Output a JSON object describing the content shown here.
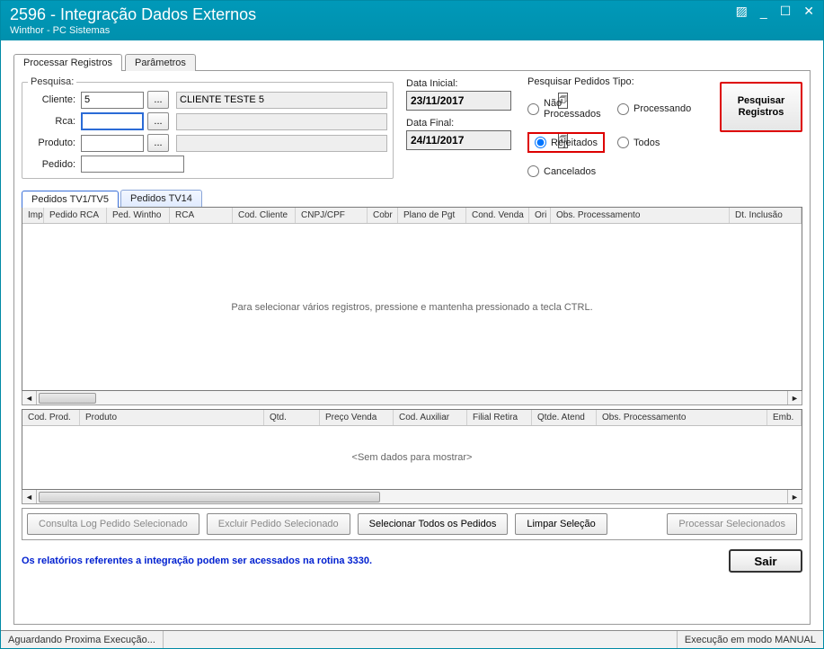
{
  "window": {
    "title": "2596 - Integração Dados Externos",
    "subtitle": "Winthor - PC Sistemas"
  },
  "tabs": {
    "main": [
      {
        "label": "Processar Registros",
        "active": true
      },
      {
        "label": "Parâmetros",
        "active": false
      }
    ],
    "sub": [
      {
        "label": "Pedidos TV1/TV5",
        "active": true
      },
      {
        "label": "Pedidos TV14",
        "active": false
      }
    ]
  },
  "pesquisa": {
    "legend": "Pesquisa:",
    "labels": {
      "cliente": "Cliente:",
      "rca": "Rca:",
      "produto": "Produto:",
      "pedido": "Pedido:"
    },
    "cliente_cod": "5",
    "cliente_desc": "CLIENTE TESTE 5",
    "rca_cod": "",
    "rca_desc": "",
    "produto_cod": "",
    "produto_desc": "",
    "pedido": "",
    "lookup_label": "..."
  },
  "dates": {
    "label_ini": "Data Inicial:",
    "value_ini": "23/11/2017",
    "label_fim": "Data Final:",
    "value_fim": "24/11/2017"
  },
  "tipo": {
    "title": "Pesquisar Pedidos Tipo:",
    "options": {
      "nao_processados": "Não Processados",
      "processando": "Processando",
      "rejeitados": "Rejeitados",
      "todos": "Todos",
      "cancelados": "Cancelados"
    },
    "selected": "rejeitados"
  },
  "buttons": {
    "pesquisar": "Pesquisar Registros",
    "consulta_log": "Consulta Log Pedido Selecionado",
    "excluir": "Excluir Pedido Selecionado",
    "selecionar_todos": "Selecionar Todos os Pedidos",
    "limpar": "Limpar Seleção",
    "processar": "Processar Selecionados",
    "sair": "Sair"
  },
  "grid1": {
    "columns": [
      "Imp",
      "Pedido RCA",
      "Ped. Wintho",
      "RCA",
      "Cod. Cliente",
      "CNPJ/CPF",
      "Cobr",
      "Plano de Pgt",
      "Cond. Venda",
      "Ori",
      "Obs. Processamento",
      "Dt. Inclusão"
    ],
    "hint": "Para selecionar vários registros, pressione e mantenha pressionado a tecla CTRL."
  },
  "grid2": {
    "columns": [
      "Cod. Prod.",
      "Produto",
      "Qtd.",
      "Preço Venda",
      "Cod. Auxiliar",
      "Filial Retira",
      "Qtde. Atend",
      "Obs. Processamento",
      "Emb."
    ],
    "empty": "<Sem dados para mostrar>"
  },
  "footer_info": "Os relatórios referentes a integração podem ser acessados na rotina 3330.",
  "status": {
    "left": "Aguardando Proxima Execução...",
    "right": "Execução em modo MANUAL"
  }
}
